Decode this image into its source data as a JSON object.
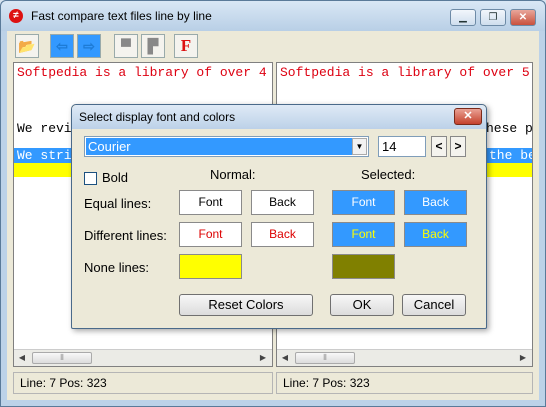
{
  "window": {
    "title": "Fast compare text files line by line",
    "icon": "not-equal-icon",
    "controls": {
      "minimize": "▁",
      "maximize": "❐",
      "close": "✕"
    }
  },
  "toolbar": {
    "open_icon": "📂",
    "prev_icon": "⇦",
    "next_icon": "⇨",
    "tool1_icon": "▀",
    "tool2_icon": "▛",
    "font_button": "F"
  },
  "left_pane": {
    "line1": "Softpedia is a library of over 4",
    "line2": "We revi",
    "line3": "We stri"
  },
  "right_pane": {
    "line1": "Softpedia is a library of over 5",
    "line2": "hese p",
    "line3": "the be"
  },
  "status": {
    "left": "Line: 7  Pos: 323",
    "right": "Line: 7  Pos: 323"
  },
  "dialog": {
    "title": "Select display font and colors",
    "font_name": "Courier",
    "font_size": "14",
    "prev_label": "<",
    "next_label": ">",
    "bold_label": "Bold",
    "normal_header": "Normal:",
    "selected_header": "Selected:",
    "equal_lines_label": "Equal lines:",
    "different_lines_label": "Different lines:",
    "none_lines_label": "None lines:",
    "font_label": "Font",
    "back_label": "Back",
    "reset_label": "Reset Colors",
    "ok_label": "OK",
    "cancel_label": "Cancel",
    "colors": {
      "none_normal": "#ffff00",
      "none_selected": "#808000",
      "selected_bg": "#3399ff",
      "different_text": "#dd0000",
      "different_selected_text": "#ffff00"
    }
  }
}
